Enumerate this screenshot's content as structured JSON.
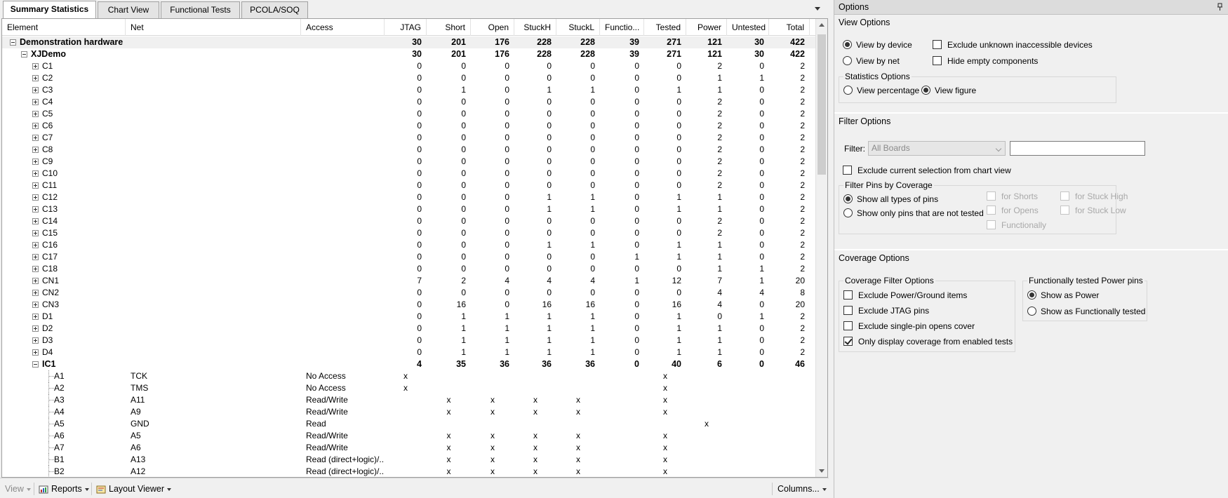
{
  "tabs": [
    "Summary Statistics",
    "Chart View",
    "Functional Tests",
    "PCOLA/SOQ"
  ],
  "active_tab": "Summary Statistics",
  "columns": [
    "Element",
    "Net",
    "Access",
    "JTAG",
    "Short",
    "Open",
    "StuckH",
    "StuckL",
    "Functio...",
    "Tested",
    "Power",
    "Untested",
    "Total"
  ],
  "rows": [
    {
      "level": 0,
      "expand": "minus",
      "bold": true,
      "shaded": true,
      "element": "Demonstration hardware",
      "net": "",
      "access": "",
      "values": [
        "30",
        "201",
        "176",
        "228",
        "228",
        "39",
        "271",
        "121",
        "30",
        "422"
      ]
    },
    {
      "level": 1,
      "expand": "minus",
      "bold": true,
      "shaded": false,
      "element": "XJDemo",
      "net": "",
      "access": "",
      "values": [
        "30",
        "201",
        "176",
        "228",
        "228",
        "39",
        "271",
        "121",
        "30",
        "422"
      ]
    },
    {
      "level": 2,
      "expand": "plus",
      "element": "C1",
      "net": "",
      "access": "",
      "values": [
        "0",
        "0",
        "0",
        "0",
        "0",
        "0",
        "0",
        "2",
        "0",
        "2"
      ]
    },
    {
      "level": 2,
      "expand": "plus",
      "element": "C2",
      "net": "",
      "access": "",
      "values": [
        "0",
        "0",
        "0",
        "0",
        "0",
        "0",
        "0",
        "1",
        "1",
        "2"
      ]
    },
    {
      "level": 2,
      "expand": "plus",
      "element": "C3",
      "net": "",
      "access": "",
      "values": [
        "0",
        "1",
        "0",
        "1",
        "1",
        "0",
        "1",
        "1",
        "0",
        "2"
      ]
    },
    {
      "level": 2,
      "expand": "plus",
      "element": "C4",
      "net": "",
      "access": "",
      "values": [
        "0",
        "0",
        "0",
        "0",
        "0",
        "0",
        "0",
        "2",
        "0",
        "2"
      ]
    },
    {
      "level": 2,
      "expand": "plus",
      "element": "C5",
      "net": "",
      "access": "",
      "values": [
        "0",
        "0",
        "0",
        "0",
        "0",
        "0",
        "0",
        "2",
        "0",
        "2"
      ]
    },
    {
      "level": 2,
      "expand": "plus",
      "element": "C6",
      "net": "",
      "access": "",
      "values": [
        "0",
        "0",
        "0",
        "0",
        "0",
        "0",
        "0",
        "2",
        "0",
        "2"
      ]
    },
    {
      "level": 2,
      "expand": "plus",
      "element": "C7",
      "net": "",
      "access": "",
      "values": [
        "0",
        "0",
        "0",
        "0",
        "0",
        "0",
        "0",
        "2",
        "0",
        "2"
      ]
    },
    {
      "level": 2,
      "expand": "plus",
      "element": "C8",
      "net": "",
      "access": "",
      "values": [
        "0",
        "0",
        "0",
        "0",
        "0",
        "0",
        "0",
        "2",
        "0",
        "2"
      ]
    },
    {
      "level": 2,
      "expand": "plus",
      "element": "C9",
      "net": "",
      "access": "",
      "values": [
        "0",
        "0",
        "0",
        "0",
        "0",
        "0",
        "0",
        "2",
        "0",
        "2"
      ]
    },
    {
      "level": 2,
      "expand": "plus",
      "element": "C10",
      "net": "",
      "access": "",
      "values": [
        "0",
        "0",
        "0",
        "0",
        "0",
        "0",
        "0",
        "2",
        "0",
        "2"
      ]
    },
    {
      "level": 2,
      "expand": "plus",
      "element": "C11",
      "net": "",
      "access": "",
      "values": [
        "0",
        "0",
        "0",
        "0",
        "0",
        "0",
        "0",
        "2",
        "0",
        "2"
      ]
    },
    {
      "level": 2,
      "expand": "plus",
      "element": "C12",
      "net": "",
      "access": "",
      "values": [
        "0",
        "0",
        "0",
        "1",
        "1",
        "0",
        "1",
        "1",
        "0",
        "2"
      ]
    },
    {
      "level": 2,
      "expand": "plus",
      "element": "C13",
      "net": "",
      "access": "",
      "values": [
        "0",
        "0",
        "0",
        "1",
        "1",
        "0",
        "1",
        "1",
        "0",
        "2"
      ]
    },
    {
      "level": 2,
      "expand": "plus",
      "element": "C14",
      "net": "",
      "access": "",
      "values": [
        "0",
        "0",
        "0",
        "0",
        "0",
        "0",
        "0",
        "2",
        "0",
        "2"
      ]
    },
    {
      "level": 2,
      "expand": "plus",
      "element": "C15",
      "net": "",
      "access": "",
      "values": [
        "0",
        "0",
        "0",
        "0",
        "0",
        "0",
        "0",
        "2",
        "0",
        "2"
      ]
    },
    {
      "level": 2,
      "expand": "plus",
      "element": "C16",
      "net": "",
      "access": "",
      "values": [
        "0",
        "0",
        "0",
        "1",
        "1",
        "0",
        "1",
        "1",
        "0",
        "2"
      ]
    },
    {
      "level": 2,
      "expand": "plus",
      "element": "C17",
      "net": "",
      "access": "",
      "values": [
        "0",
        "0",
        "0",
        "0",
        "0",
        "1",
        "1",
        "1",
        "0",
        "2"
      ]
    },
    {
      "level": 2,
      "expand": "plus",
      "element": "C18",
      "net": "",
      "access": "",
      "values": [
        "0",
        "0",
        "0",
        "0",
        "0",
        "0",
        "0",
        "1",
        "1",
        "2"
      ]
    },
    {
      "level": 2,
      "expand": "plus",
      "element": "CN1",
      "net": "",
      "access": "",
      "values": [
        "7",
        "2",
        "4",
        "4",
        "4",
        "1",
        "12",
        "7",
        "1",
        "20"
      ]
    },
    {
      "level": 2,
      "expand": "plus",
      "element": "CN2",
      "net": "",
      "access": "",
      "values": [
        "0",
        "0",
        "0",
        "0",
        "0",
        "0",
        "0",
        "4",
        "4",
        "8"
      ]
    },
    {
      "level": 2,
      "expand": "plus",
      "element": "CN3",
      "net": "",
      "access": "",
      "values": [
        "0",
        "16",
        "0",
        "16",
        "16",
        "0",
        "16",
        "4",
        "0",
        "20"
      ]
    },
    {
      "level": 2,
      "expand": "plus",
      "element": "D1",
      "net": "",
      "access": "",
      "values": [
        "0",
        "1",
        "1",
        "1",
        "1",
        "0",
        "1",
        "0",
        "1",
        "2"
      ]
    },
    {
      "level": 2,
      "expand": "plus",
      "element": "D2",
      "net": "",
      "access": "",
      "values": [
        "0",
        "1",
        "1",
        "1",
        "1",
        "0",
        "1",
        "1",
        "0",
        "2"
      ]
    },
    {
      "level": 2,
      "expand": "plus",
      "element": "D3",
      "net": "",
      "access": "",
      "values": [
        "0",
        "1",
        "1",
        "1",
        "1",
        "0",
        "1",
        "1",
        "0",
        "2"
      ]
    },
    {
      "level": 2,
      "expand": "plus",
      "element": "D4",
      "net": "",
      "access": "",
      "values": [
        "0",
        "1",
        "1",
        "1",
        "1",
        "0",
        "1",
        "1",
        "0",
        "2"
      ]
    },
    {
      "level": 2,
      "expand": "minus",
      "bold": true,
      "element": "IC1",
      "net": "",
      "access": "",
      "values": [
        "4",
        "35",
        "36",
        "36",
        "36",
        "0",
        "40",
        "6",
        "0",
        "46"
      ]
    },
    {
      "level": 3,
      "expand": "none",
      "element": "A1",
      "net": "TCK",
      "access": "No Access",
      "values": [
        "x",
        "",
        "",
        "",
        "",
        "",
        "x",
        "",
        "",
        ""
      ]
    },
    {
      "level": 3,
      "expand": "none",
      "element": "A2",
      "net": "TMS",
      "access": "No Access",
      "values": [
        "x",
        "",
        "",
        "",
        "",
        "",
        "x",
        "",
        "",
        ""
      ]
    },
    {
      "level": 3,
      "expand": "none",
      "element": "A3",
      "net": "A11",
      "access": "Read/Write",
      "values": [
        "",
        "x",
        "x",
        "x",
        "x",
        "",
        "x",
        "",
        "",
        ""
      ]
    },
    {
      "level": 3,
      "expand": "none",
      "element": "A4",
      "net": "A9",
      "access": "Read/Write",
      "values": [
        "",
        "x",
        "x",
        "x",
        "x",
        "",
        "x",
        "",
        "",
        ""
      ]
    },
    {
      "level": 3,
      "expand": "none",
      "element": "A5",
      "net": "GND",
      "access": "Read",
      "values": [
        "",
        "",
        "",
        "",
        "",
        "",
        "",
        "x",
        "",
        ""
      ]
    },
    {
      "level": 3,
      "expand": "none",
      "element": "A6",
      "net": "A5",
      "access": "Read/Write",
      "values": [
        "",
        "x",
        "x",
        "x",
        "x",
        "",
        "x",
        "",
        "",
        ""
      ]
    },
    {
      "level": 3,
      "expand": "none",
      "element": "A7",
      "net": "A6",
      "access": "Read/Write",
      "values": [
        "",
        "x",
        "x",
        "x",
        "x",
        "",
        "x",
        "",
        "",
        ""
      ]
    },
    {
      "level": 3,
      "expand": "none",
      "element": "B1",
      "net": "A13",
      "access": "Read (direct+logic)/...",
      "values": [
        "",
        "x",
        "x",
        "x",
        "x",
        "",
        "x",
        "",
        "",
        ""
      ]
    },
    {
      "level": 3,
      "expand": "none",
      "element": "B2",
      "net": "A12",
      "access": "Read (direct+logic)/...",
      "values": [
        "",
        "x",
        "x",
        "x",
        "x",
        "",
        "x",
        "",
        "",
        ""
      ]
    }
  ],
  "statusbar": {
    "view_label": "View",
    "reports_label": "Reports",
    "layout_viewer_label": "Layout Viewer",
    "columns_label": "Columns..."
  },
  "options": {
    "title": "Options",
    "view_options": {
      "heading": "View Options",
      "view_by_device": "View by device",
      "view_by_net": "View by net",
      "exclude_unknown": "Exclude unknown inaccessible devices",
      "hide_empty": "Hide empty components",
      "stats_group": "Statistics Options",
      "view_percentage": "View percentage",
      "view_figure": "View figure"
    },
    "filter_options": {
      "heading": "Filter Options",
      "filter_label": "Filter:",
      "filter_select": "All Boards",
      "filter_text": "",
      "exclude_selection": "Exclude current selection from chart view",
      "pins_group": "Filter Pins by Coverage",
      "show_all": "Show all types of pins",
      "show_not_tested": "Show only pins that are not tested",
      "for_shorts": "for Shorts",
      "for_opens": "for Opens",
      "functionally": "Functionally",
      "for_stuck_high": "for Stuck High",
      "for_stuck_low": "for Stuck Low"
    },
    "coverage_options": {
      "heading": "Coverage Options",
      "filter_group": "Coverage Filter Options",
      "exclude_power": "Exclude Power/Ground items",
      "exclude_jtag": "Exclude JTAG pins",
      "exclude_single": "Exclude single-pin opens cover",
      "only_enabled": "Only display coverage from enabled tests",
      "power_group": "Functionally tested Power pins",
      "show_as_power": "Show as Power",
      "show_as_functional": "Show as Functionally tested"
    }
  }
}
